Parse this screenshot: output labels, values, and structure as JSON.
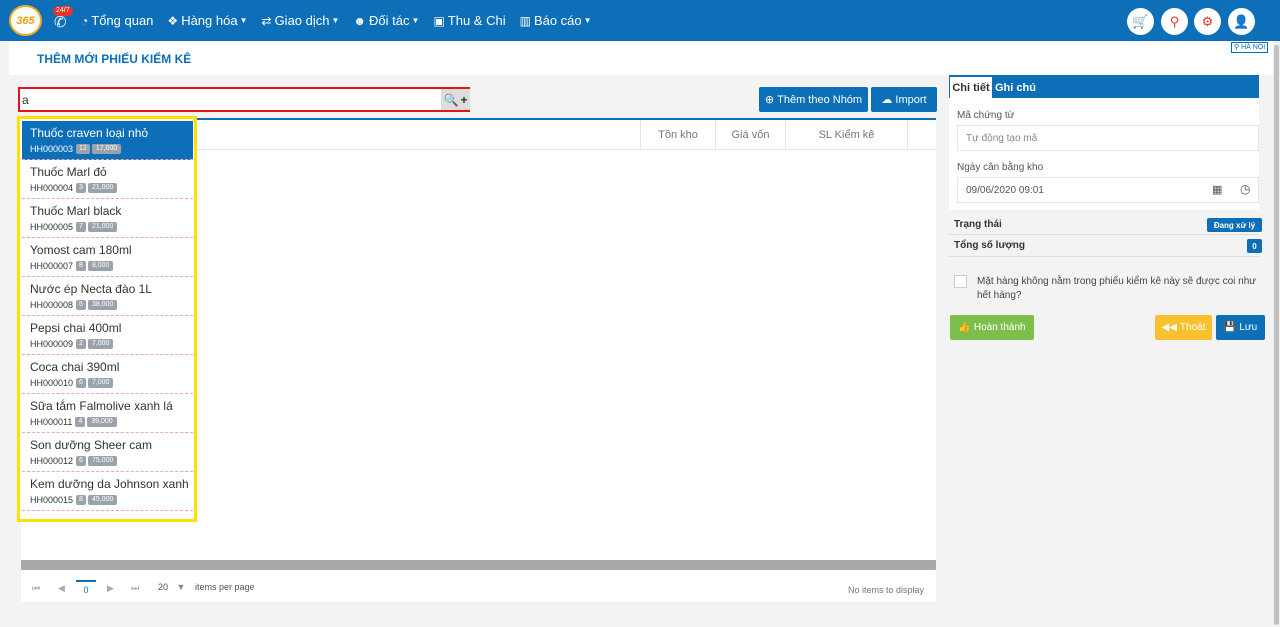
{
  "nav": {
    "logo_text": "365",
    "phone_badge": "24/7",
    "items": [
      {
        "label": "Tổng quan",
        "icon": "dashboard-icon",
        "dropdown": false
      },
      {
        "label": "Hàng hóa",
        "icon": "cubes-icon",
        "dropdown": true
      },
      {
        "label": "Giao dịch",
        "icon": "exchange-icon",
        "dropdown": true
      },
      {
        "label": "Đối tác",
        "icon": "users-icon",
        "dropdown": true
      },
      {
        "label": "Thu & Chi",
        "icon": "money-icon",
        "dropdown": false
      },
      {
        "label": "Báo cáo",
        "icon": "bar-chart-icon",
        "dropdown": true
      }
    ],
    "right_icons": [
      "cart-icon",
      "location-icon",
      "gear-icon",
      "user-icon"
    ],
    "accent_color": "#0d6fb8",
    "icon_color": "#e8342d"
  },
  "header": {
    "page_title": "THÊM MỚI PHIẾU KIỂM KÊ",
    "region": "HÀ NỘI"
  },
  "search": {
    "value": "a",
    "placeholder": ""
  },
  "toolbar": {
    "add_group_label": "Thêm theo Nhóm",
    "import_label": "Import"
  },
  "grid": {
    "columns": [
      "Tồn kho",
      "Giá vốn",
      "SL Kiểm kê"
    ],
    "pager": {
      "current_page": "0",
      "page_size": "20",
      "items_per_page_label": "items per page",
      "empty_label": "No items to display"
    }
  },
  "dropdown": {
    "items": [
      {
        "name": "Thuốc craven loại nhỏ",
        "code": "HH000003",
        "qty": "12",
        "price": "17,000",
        "active": true
      },
      {
        "name": "Thuốc Marl đỏ",
        "code": "HH000004",
        "qty": "3",
        "price": "21,000",
        "active": false
      },
      {
        "name": "Thuốc Marl black",
        "code": "HH000005",
        "qty": "7",
        "price": "21,000",
        "active": false
      },
      {
        "name": "Yomost cam 180ml",
        "code": "HH000007",
        "qty": "8",
        "price": "8,000",
        "active": false
      },
      {
        "name": "Nước ép Necta đào 1L",
        "code": "HH000008",
        "qty": "5",
        "price": "38,000",
        "active": false
      },
      {
        "name": "Pepsi chai 400ml",
        "code": "HH000009",
        "qty": "2",
        "price": "7,000",
        "active": false
      },
      {
        "name": "Coca chai 390ml",
        "code": "HH000010",
        "qty": "6",
        "price": "7,000",
        "active": false
      },
      {
        "name": "Sữa tắm Falmolive xanh lá",
        "code": "HH000011",
        "qty": "4",
        "price": "39,000",
        "active": false
      },
      {
        "name": "Son dưỡng Sheer cam",
        "code": "HH000012",
        "qty": "6",
        "price": "75,000",
        "active": false
      },
      {
        "name": "Kem dưỡng da Johnson xanh",
        "code": "HH000015",
        "qty": "8",
        "price": "45,000",
        "active": false
      }
    ]
  },
  "panel": {
    "tab_detail": "Chi tiết",
    "tab_note": "Ghi chú",
    "voucher_label": "Mã chứng từ",
    "voucher_placeholder": "Tự động tạo mã",
    "date_label": "Ngày cân bằng kho",
    "date_value": "09/06/2020 09:01",
    "status_label": "Trạng thái",
    "status_value": "Đang xử lý",
    "total_label": "Tổng số lượng",
    "total_value": "0",
    "note_text": "Mặt hàng không nằm trong phiếu kiểm kê này sẽ được coi như hết hàng?",
    "complete_label": "Hoàn thành",
    "exit_label": "Thoát",
    "save_label": "Lưu"
  }
}
